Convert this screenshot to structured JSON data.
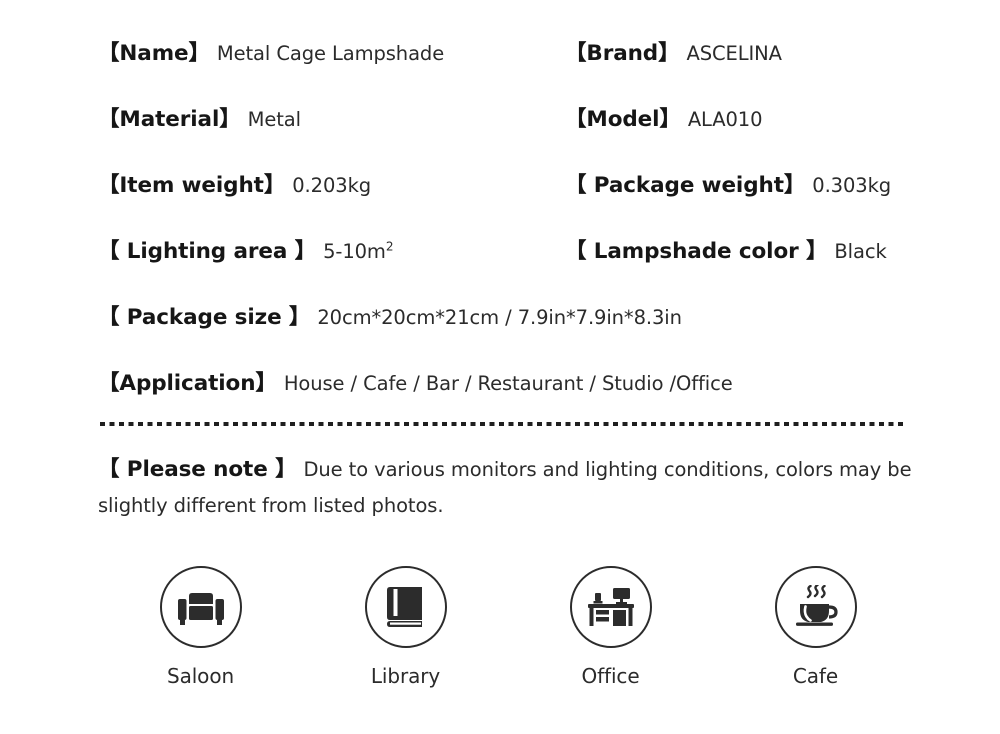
{
  "product_spec": {
    "rows": [
      {
        "left": {
          "label": "【Name】",
          "value": "Metal Cage Lampshade"
        },
        "right": {
          "label": "【Brand】",
          "value": "ASCELINA"
        }
      },
      {
        "left": {
          "label": "【Material】",
          "value": "Metal"
        },
        "right": {
          "label": "【Model】",
          "value": "ALA010"
        }
      },
      {
        "left": {
          "label": "【Item weight】",
          "value": "0.203kg"
        },
        "right": {
          "label": "【 Package weight】",
          "value": "0.303kg"
        }
      },
      {
        "left": {
          "label": "【 Lighting area 】",
          "value": "5-10m",
          "superscript": "2"
        },
        "right": {
          "label": "【 Lampshade color 】",
          "value": "Black"
        }
      }
    ],
    "full_rows": [
      {
        "label": "【 Package size 】",
        "value": "20cm*20cm*21cm / 7.9in*7.9in*8.3in"
      },
      {
        "label": "【Application】",
        "value": "House / Cafe / Bar / Restaurant / Studio /Office"
      }
    ]
  },
  "note": {
    "label": "【 Please note 】",
    "text": "Due to various monitors and lighting conditions, colors may be slightly different from listed photos."
  },
  "usages": [
    {
      "label": "Saloon",
      "icon": "armchair-icon"
    },
    {
      "label": "Library",
      "icon": "book-icon"
    },
    {
      "label": "Office",
      "icon": "desk-icon"
    },
    {
      "label": "Cafe",
      "icon": "coffee-cup-icon"
    }
  ],
  "colors": {
    "background": "#ffffff",
    "text": "#2b2b2b",
    "label": "#161616",
    "icon": "#2c2c2c"
  }
}
